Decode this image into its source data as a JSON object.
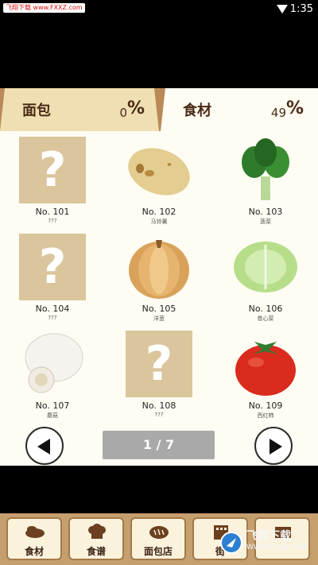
{
  "status_bar": {
    "badge": "飞翔下载 www.FXXZ.com",
    "time": "1:35"
  },
  "tabs": [
    {
      "label": "面包",
      "value": "0",
      "unit": "%"
    },
    {
      "label": "食材",
      "value": "49",
      "unit": "%"
    }
  ],
  "items": [
    {
      "number": "No. 101",
      "name": "???",
      "icon": "unknown-icon",
      "known": false
    },
    {
      "number": "No. 102",
      "name": "马铃薯",
      "icon": "potato-icon",
      "known": true
    },
    {
      "number": "No. 103",
      "name": "菠菜",
      "icon": "spinach-icon",
      "known": true
    },
    {
      "number": "No. 104",
      "name": "???",
      "icon": "unknown-icon",
      "known": false
    },
    {
      "number": "No. 105",
      "name": "洋葱",
      "icon": "onion-icon",
      "known": true
    },
    {
      "number": "No. 106",
      "name": "卷心菜",
      "icon": "cabbage-icon",
      "known": true
    },
    {
      "number": "No. 107",
      "name": "蘑菇",
      "icon": "mushroom-icon",
      "known": true
    },
    {
      "number": "No. 108",
      "name": "???",
      "icon": "unknown-icon",
      "known": false
    },
    {
      "number": "No. 109",
      "name": "西红柿",
      "icon": "tomato-icon",
      "known": true
    }
  ],
  "unknown_mark": "?",
  "pager": {
    "text": "1 / 7"
  },
  "bottom_nav": [
    {
      "label": "食材",
      "icon": "food-icon"
    },
    {
      "label": "食谱",
      "icon": "chef-hat-icon"
    },
    {
      "label": "面包店",
      "icon": "bread-icon"
    },
    {
      "label": "街",
      "icon": "building-icon"
    },
    {
      "label": "",
      "icon": "box-icon"
    }
  ],
  "watermark": {
    "text": "飞翔下载",
    "url": "WWW.FXXZ.COM"
  },
  "colors": {
    "tab_bar": "#b98a55",
    "panel": "#fffdf3",
    "unknown_tile": "#dac59c",
    "pager": "#a9a9a9",
    "bottom_bar": "#c69f6f"
  }
}
